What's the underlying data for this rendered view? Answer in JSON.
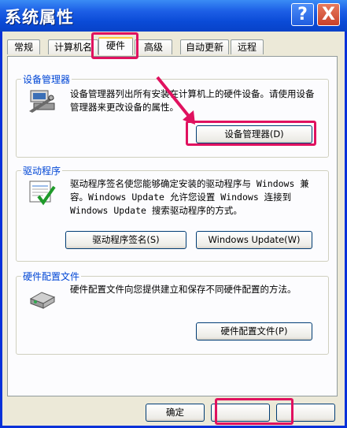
{
  "window": {
    "title": "系统属性"
  },
  "titlebar_buttons": {
    "help": "?",
    "close": "X"
  },
  "tabs": [
    "常规",
    "计算机名",
    "硬件",
    "高级",
    "自动更新",
    "远程"
  ],
  "device_manager": {
    "title": "设备管理器",
    "description": "设备管理器列出所有安装在计算机上的硬件设备。请使用设备管理器来更改设备的属性。",
    "button": "设备管理器(D)"
  },
  "drivers": {
    "title": "驱动程序",
    "description": "驱动程序签名使您能够确定安装的驱动程序与 Windows 兼容。Windows Update 允许您设置 Windows 连接到 Windows Update 搜索驱动程序的方式。",
    "signing_button": "驱动程序签名(S)",
    "update_button": "Windows Update(W)"
  },
  "hardware_profiles": {
    "title": "硬件配置文件",
    "description": "硬件配置文件向您提供建立和保存不同硬件配置的方法。",
    "button": "硬件配置文件(P)"
  },
  "footer": {
    "ok_button": "确定"
  },
  "colors": {
    "highlight": "#e0115f",
    "group_title": "#0046d5"
  }
}
